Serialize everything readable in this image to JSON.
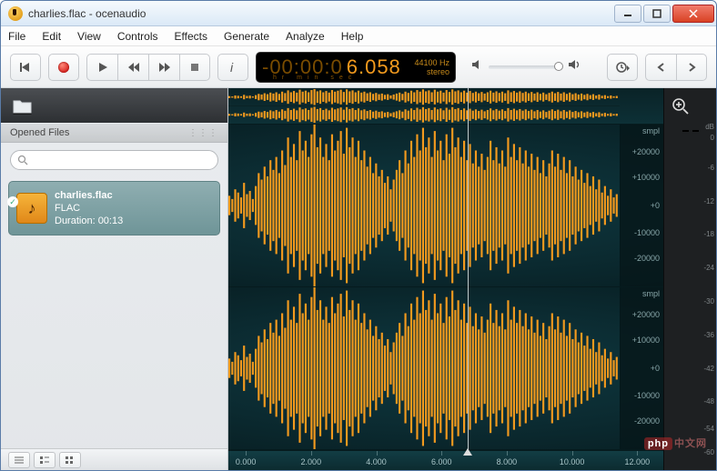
{
  "window": {
    "title": "charlies.flac - ocenaudio"
  },
  "menu": {
    "file": "File",
    "edit": "Edit",
    "view": "View",
    "controls": "Controls",
    "effects": "Effects",
    "generate": "Generate",
    "analyze": "Analyze",
    "help": "Help"
  },
  "toolbar": {
    "time_dim": "-00:00:0",
    "time_bright": "6.058",
    "time_units": "hr  min  sec",
    "sample_rate": "44100 Hz",
    "channel_mode": "stereo"
  },
  "sidebar": {
    "header": "Opened Files",
    "search_placeholder": "",
    "items": [
      {
        "filename": "charlies.flac",
        "format": "FLAC",
        "duration_label": "Duration: 00:13"
      }
    ]
  },
  "waveform": {
    "vert_unit": "smpl",
    "vert_ticks": [
      "+20000",
      "+10000",
      "+0",
      "-10000",
      "-20000"
    ],
    "time_ticks": [
      "0.000",
      "2.000",
      "4.000",
      "6.000",
      "8.000",
      "10.000",
      "12.000"
    ]
  },
  "meters": {
    "db_label": "dB",
    "scale": [
      "0",
      "-6",
      "-12",
      "-18",
      "-24",
      "-30",
      "-36",
      "-42",
      "-48",
      "-54",
      "-60"
    ]
  },
  "watermark": {
    "brand": "php",
    "text": "中文网"
  }
}
